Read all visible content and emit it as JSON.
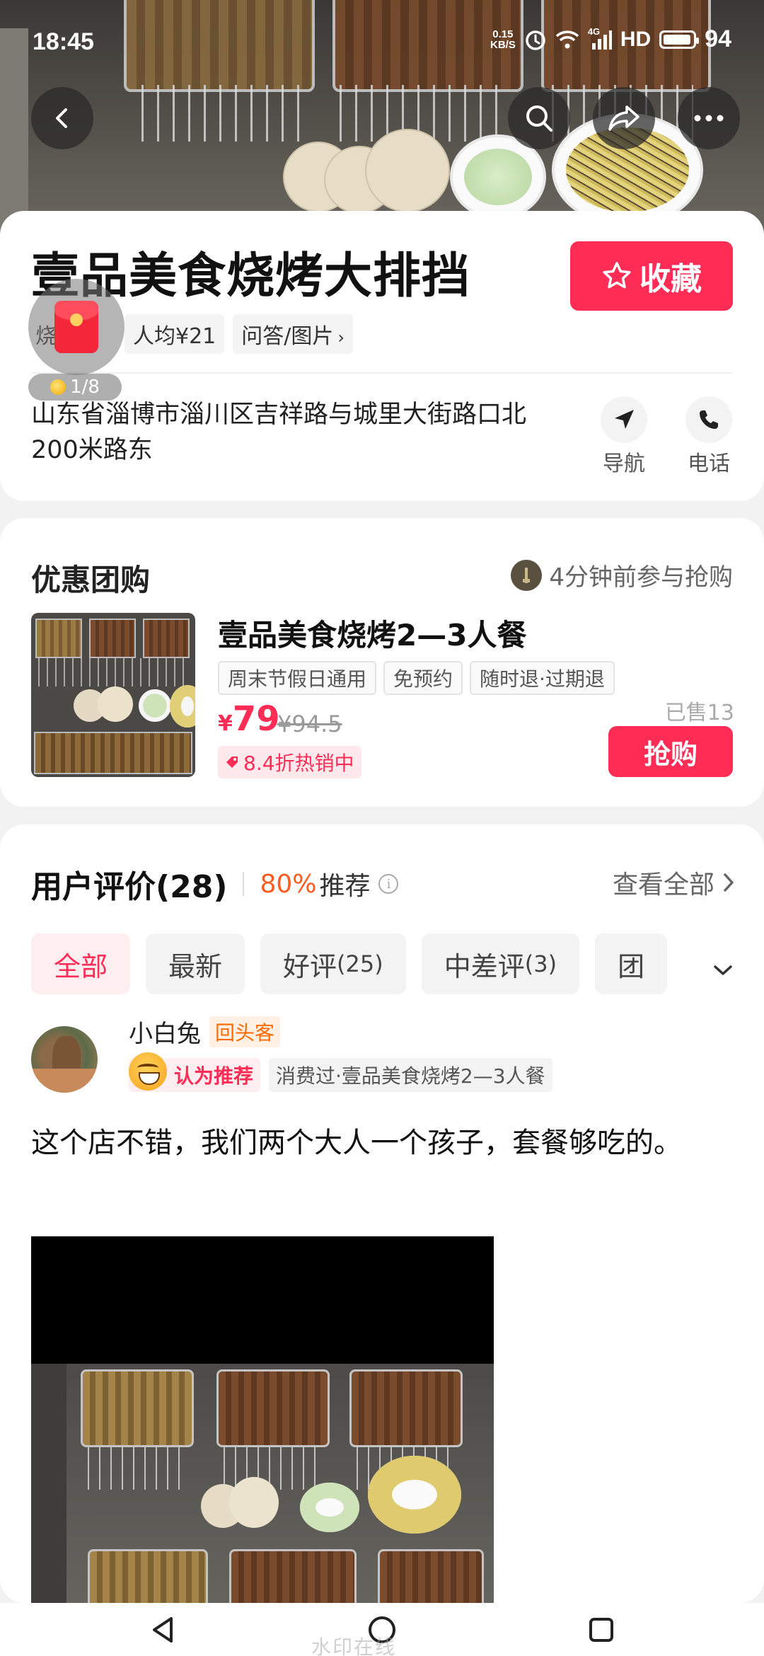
{
  "status_bar": {
    "time": "18:45",
    "net_speed_value": "0.15",
    "net_speed_unit": "KB/S",
    "network": "4G",
    "hd": "HD",
    "battery": "94",
    "battery_level": 0.94
  },
  "top_nav": {
    "back_icon": "chevron-left-icon",
    "search_icon": "search-icon",
    "share_icon": "share-icon",
    "more_icon": "more-icon"
  },
  "shop": {
    "name": "壹品美食烧烤大排挡",
    "favorite_label": "收藏",
    "category": "烧",
    "avg_price": "人均¥21",
    "qa_photos": "问答/图片",
    "photo_index": "1/8",
    "address": "山东省淄博市淄川区吉祥路与城里大街路口北200米路东",
    "nav_label": "导航",
    "call_label": "电话"
  },
  "deal": {
    "section_title": "优惠团购",
    "recent_activity": "4分钟前参与抢购",
    "name": "壹品美食烧烤2—3人餐",
    "tags": [
      "周末节假日通用",
      "免预约",
      "随时退·过期退"
    ],
    "currency": "¥",
    "price": "79",
    "original_price": "¥94.5",
    "discount": "8.4折热销中",
    "sold": "已售13",
    "buy_label": "抢购"
  },
  "reviews": {
    "title": "用户评价(28)",
    "recommend_pct": "80%",
    "recommend_label": "推荐",
    "see_all": "查看全部",
    "filters": [
      {
        "label": "全部",
        "count": ""
      },
      {
        "label": "最新",
        "count": ""
      },
      {
        "label": "好评",
        "count": "(25)"
      },
      {
        "label": "中差评",
        "count": "(3)"
      },
      {
        "label": "团",
        "count": ""
      }
    ],
    "item": {
      "user_name": "小白兔",
      "returning_badge": "回头客",
      "recommend_badge": "认为推荐",
      "consumed": "消费过·壹品美食烧烤2—3人餐",
      "text": "这个店不错，我们两个大人一个孩子，套餐够吃的。"
    }
  },
  "watermark": "水印在线",
  "colors": {
    "accent": "#ff2d55",
    "recommend_orange": "#ff5a1f",
    "returning_orange": "#ff6a00"
  }
}
